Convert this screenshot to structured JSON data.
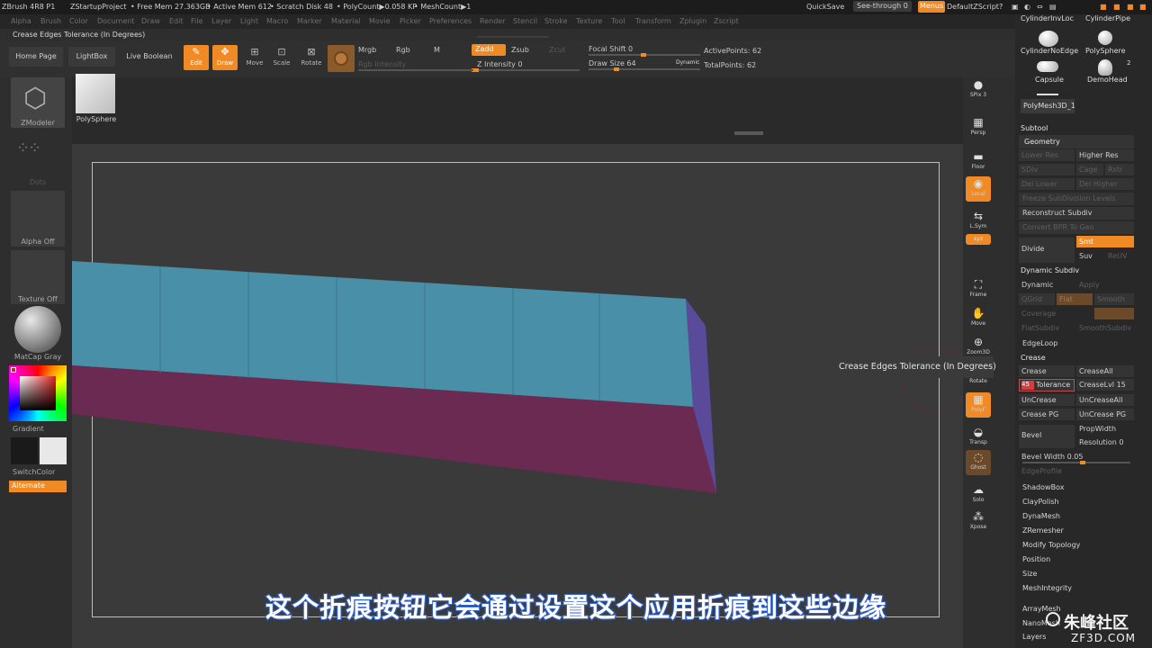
{
  "titlebar": {
    "app": "ZBrush 4R8 P1",
    "project": "ZStartupProject",
    "free_mem": "• Free Mem 27.363GB",
    "active_mem": "• Active Mem 612",
    "scratch": "• Scratch Disk 48",
    "polycount": "• PolyCount▶0.058 KP",
    "meshcount": "• MeshCount▶1",
    "quicksave": "QuickSave",
    "see_through": "See-through  0",
    "menus": "Menus",
    "default_script": "DefaultZScript"
  },
  "menubar": [
    "Alpha",
    "Brush",
    "Color",
    "Document",
    "Draw",
    "Edit",
    "File",
    "Layer",
    "Light",
    "Macro",
    "Marker",
    "Material",
    "Movie",
    "Picker",
    "Preferences",
    "Render",
    "Stencil",
    "Stroke",
    "Texture",
    "Tool",
    "Transform",
    "Zplugin",
    "Zscript"
  ],
  "tooltip_bar": "Crease Edges Tolerance (In Degrees)",
  "toolbar": {
    "home_page": "Home Page",
    "lightbox": "LightBox",
    "live_boolean": "Live Boolean",
    "edit": "Edit",
    "draw": "Draw",
    "move": "Move",
    "scale": "Scale",
    "rotate": "Rotate",
    "mrgb": "Mrgb",
    "rgb": "Rgb",
    "m": "M",
    "rgb_intensity": "Rgb Intensity",
    "zadd": "Zadd",
    "zsub": "Zsub",
    "zcut": "Zcut",
    "z_intensity": "Z Intensity 0",
    "focal_shift": "Focal Shift 0",
    "draw_size": "Draw Size 64",
    "dynamic": "Dynamic",
    "active_points": "ActivePoints: 62",
    "total_points": "TotalPoints: 62"
  },
  "left_panel": {
    "zmodeler": "ZModeler",
    "polysphere": "PolySphere",
    "dots": "Dots",
    "alpha_off": "Alpha Off",
    "texture_off": "Texture Off",
    "matcap": "MatCap Gray",
    "gradient": "Gradient",
    "switchcolor": "SwitchColor",
    "alternate": "Alternate"
  },
  "right_toolbar": [
    {
      "label": "SPix 3",
      "icon": "sphere-icon"
    },
    {
      "label": "Persp",
      "icon": "perspective-icon"
    },
    {
      "label": "Floor",
      "icon": "floor-icon"
    },
    {
      "label": "Local",
      "icon": "local-icon"
    },
    {
      "label": "L.Sym",
      "icon": "symmetry-icon"
    },
    {
      "label": "Gxyz",
      "icon": "axis-icon"
    },
    {
      "label": "Frame",
      "icon": "frame-icon"
    },
    {
      "label": "Move",
      "icon": "move-icon"
    },
    {
      "label": "Zoom3D",
      "icon": "zoom-icon"
    },
    {
      "label": "Rotate",
      "icon": "rotate-icon"
    },
    {
      "label": "PolyF",
      "icon": "polyframe-icon"
    },
    {
      "label": "Transp",
      "icon": "transparency-icon"
    },
    {
      "label": "Ghost",
      "icon": "ghost-icon"
    },
    {
      "label": "Solo",
      "icon": "solo-icon"
    },
    {
      "label": "Xpose",
      "icon": "xpose-icon"
    }
  ],
  "right_panel": {
    "tools": [
      "CylinderInvLoc",
      "CylinderPipe",
      "CylinderNoEdge",
      "PolySphere",
      "Capsule",
      "DemoHead",
      "PolyMesh3D_1"
    ],
    "demohead_count": "2",
    "subtool": "Subtool",
    "geometry": "Geometry",
    "lower_res": "Lower Res",
    "higher_res": "Higher Res",
    "sdiv": "SDiv",
    "cage": "Cage",
    "rstr": "Rstr",
    "del_lower": "Del Lower",
    "del_higher": "Del Higher",
    "freeze_subdiv": "Freeze SubDivision Levels",
    "reconstruct_subdiv": "Reconstruct Subdiv",
    "convert_bpr": "Convert BPR To Geo",
    "divide": "Divide",
    "smt": "Smt",
    "suv": "Suv",
    "reuv": "ReUV",
    "dynamic_subdiv": "Dynamic Subdiv",
    "dynamic": "Dynamic",
    "apply": "Apply",
    "qgrid": "QGrid",
    "flat": "Flat",
    "smooth": "Smooth",
    "coverage": "Coverage",
    "flatsubdiv": "FlatSubdiv",
    "smoothsubdiv": "SmoothSubdiv",
    "edgeloop": "EdgeLoop",
    "crease": "Crease",
    "crease_btn": "Crease",
    "crease_all": "CreaseAll",
    "tolerance_value": "45",
    "tolerance_label": "Tolerance",
    "crease_lvl": "CreaseLvl 15",
    "uncrease": "UnCrease",
    "uncrease_all": "UnCreaseAll",
    "crease_pg": "Crease PG",
    "uncrease_pg": "UnCrease PG",
    "bevel": "Bevel",
    "propwidth": "PropWidth",
    "resolution": "Resolution 0",
    "bevel_width": "Bevel Width 0.05",
    "edge_profile": "EdgeProfile",
    "list": [
      "ShadowBox",
      "ClayPolish",
      "DynaMesh",
      "ZRemesher",
      "Modify Topology",
      "Position",
      "Size",
      "MeshIntegrity"
    ],
    "arraymesh": "ArrayMesh",
    "nanomesh": "NanoMesh",
    "layers": "Layers"
  },
  "canvas_tooltip": "Crease Edges Tolerance (In Degrees)",
  "subtitle": "这个折痕按钮它会通过设置这个应用折痕到这些边缘",
  "watermark": {
    "name": "朱峰社区",
    "url": "ZF3D.COM"
  },
  "colors": {
    "accent": "#f08a24",
    "cube_top": "#4a8fa8",
    "cube_front": "#6a2a52",
    "cube_side": "#5a4a9a"
  }
}
